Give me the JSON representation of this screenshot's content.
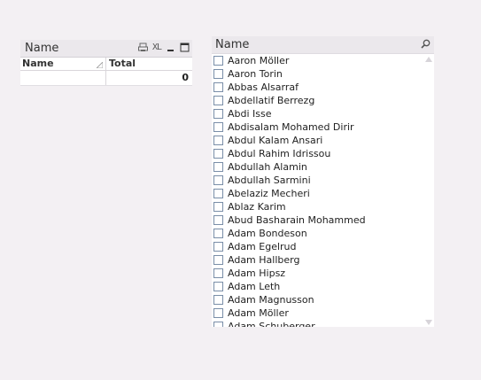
{
  "table_box": {
    "title": "Name",
    "xl_label": "XL",
    "columns": [
      "Name",
      "Total"
    ],
    "rows": [
      {
        "name": "",
        "total": "0"
      }
    ]
  },
  "list_box": {
    "title": "Name",
    "items": [
      "Aaron Möller",
      "Aaron Torin",
      "Abbas Alsarraf",
      "Abdellatif Berrezg",
      "Abdi Isse",
      "Abdisalam Mohamed Dirir",
      "Abdul Kalam Ansari",
      "Abdul Rahim Idrissou",
      "Abdullah Alamin",
      "Abdullah Sarmini",
      "Abelaziz Mecheri",
      "Ablaz Karim",
      "Abud Basharain Mohammed",
      "Adam Bondeson",
      "Adam Egelrud",
      "Adam Hallberg",
      "Adam Hipsz",
      "Adam Leth",
      "Adam Magnusson",
      "Adam Möller",
      "Adam Schuberger"
    ]
  },
  "colors": {
    "background": "#f3f0f3",
    "caption": "#ebe8ec",
    "checkbox_border": "#7a8ea8"
  },
  "icons": [
    "print-icon",
    "xl-export-icon",
    "minimize-icon",
    "maximize-icon",
    "search-icon",
    "scroll-up-icon",
    "scroll-down-icon",
    "sort-icon"
  ]
}
